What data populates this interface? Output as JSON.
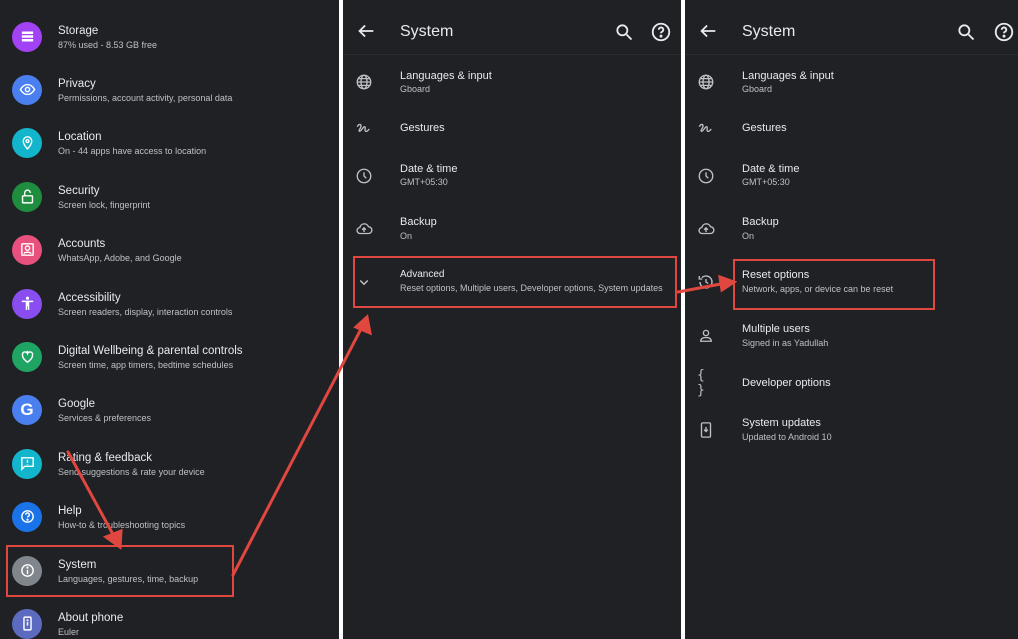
{
  "settings": {
    "items": [
      {
        "title": "Storage",
        "subtitle": "87% used - 8.53 GB free",
        "icon": "storage-icon",
        "color": "#a142f4"
      },
      {
        "title": "Privacy",
        "subtitle": "Permissions, account activity, personal data",
        "icon": "eye-icon",
        "color": "#4a7ff0"
      },
      {
        "title": "Location",
        "subtitle": "On - 44 apps have access to location",
        "icon": "location-pin-icon",
        "color": "#12b5cb"
      },
      {
        "title": "Security",
        "subtitle": "Screen lock, fingerprint",
        "icon": "lock-icon",
        "color": "#1e8e3e"
      },
      {
        "title": "Accounts",
        "subtitle": "WhatsApp, Adobe, and Google",
        "icon": "account-box-icon",
        "color": "#e8517e"
      },
      {
        "title": "Accessibility",
        "subtitle": "Screen readers, display, interaction controls",
        "icon": "accessibility-icon",
        "color": "#8a4df0"
      },
      {
        "title": "Digital Wellbeing & parental controls",
        "subtitle": "Screen time, app timers, bedtime schedules",
        "icon": "wellbeing-heart-icon",
        "color": "#1fa463"
      },
      {
        "title": "Google",
        "subtitle": "Services & preferences",
        "icon": "google-g-icon",
        "color": "#4a7ff0"
      },
      {
        "title": "Rating & feedback",
        "subtitle": "Send suggestions & rate your device",
        "icon": "feedback-icon",
        "color": "#12b5cb"
      },
      {
        "title": "Help",
        "subtitle": "How-to & troubleshooting topics",
        "icon": "help-icon",
        "color": "#1a73e8"
      },
      {
        "title": "System",
        "subtitle": "Languages, gestures, time, backup",
        "icon": "info-icon",
        "color": "#80868b"
      },
      {
        "title": "About phone",
        "subtitle": "Euler",
        "icon": "phone-icon",
        "color": "#5c6bc0"
      }
    ]
  },
  "system_collapsed": {
    "title": "System",
    "items": [
      {
        "title": "Languages & input",
        "subtitle": "Gboard",
        "icon": "globe-icon"
      },
      {
        "title": "Gestures",
        "subtitle": "",
        "icon": "gesture-icon"
      },
      {
        "title": "Date & time",
        "subtitle": "GMT+05:30",
        "icon": "clock-icon"
      },
      {
        "title": "Backup",
        "subtitle": "On",
        "icon": "cloud-upload-icon"
      },
      {
        "title": "Advanced",
        "subtitle": "Reset options, Multiple users, Developer options, System updates",
        "icon": "chevron-down-icon"
      }
    ]
  },
  "system_expanded": {
    "title": "System",
    "items": [
      {
        "title": "Languages & input",
        "subtitle": "Gboard",
        "icon": "globe-icon"
      },
      {
        "title": "Gestures",
        "subtitle": "",
        "icon": "gesture-icon"
      },
      {
        "title": "Date & time",
        "subtitle": "GMT+05:30",
        "icon": "clock-icon"
      },
      {
        "title": "Backup",
        "subtitle": "On",
        "icon": "cloud-upload-icon"
      },
      {
        "title": "Reset options",
        "subtitle": "Network, apps, or device can be reset",
        "icon": "history-icon"
      },
      {
        "title": "Multiple users",
        "subtitle": "Signed in as Yadullah",
        "icon": "person-icon"
      },
      {
        "title": "Developer options",
        "subtitle": "",
        "icon": "code-braces-icon"
      },
      {
        "title": "System updates",
        "subtitle": "Updated to Android 10",
        "icon": "system-update-icon"
      }
    ]
  },
  "annotation": {
    "highlight_color": "#e0473f"
  }
}
